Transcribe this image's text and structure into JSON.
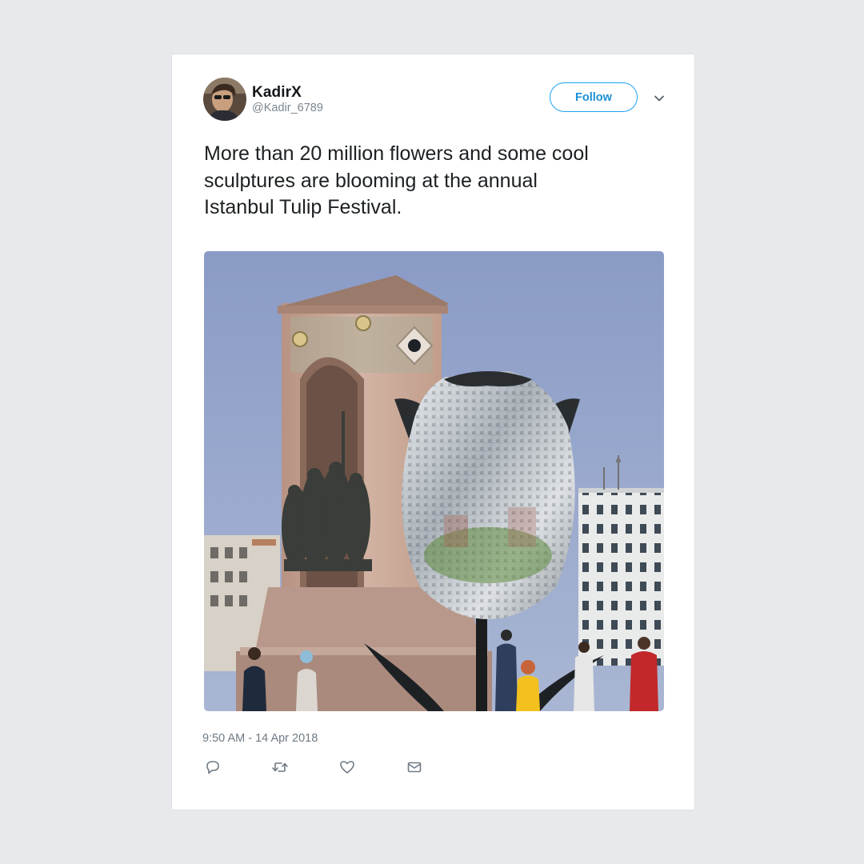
{
  "tweet": {
    "display_name": "KadirX",
    "handle": "@Kadir_6789",
    "follow_label": "Follow",
    "text": "More than 20 million flowers and some cool\nsculptures are blooming at the annual\nIstanbul Tulip Festival.",
    "timestamp": "9:50 AM - 14 Apr 2018"
  },
  "icons": {
    "menu": "chevron-down-icon",
    "reply": "reply-icon",
    "retweet": "retweet-icon",
    "like": "heart-icon",
    "message": "envelope-icon"
  },
  "colors": {
    "page_background": "#e8e9ec",
    "card_background": "#ffffff",
    "accent": "#1da1f2",
    "text_primary": "#14171a",
    "text_secondary": "#7a858f"
  }
}
